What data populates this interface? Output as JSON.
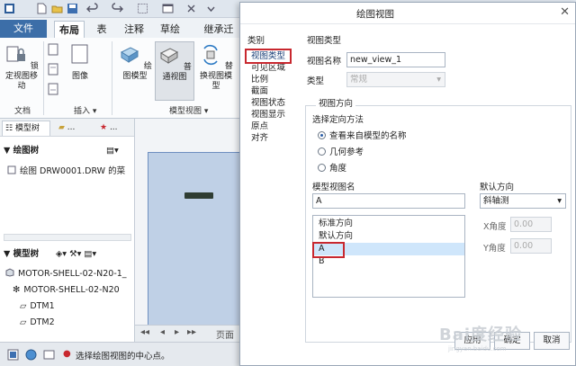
{
  "ribbon": {
    "tabs": [
      "文件",
      "布局",
      "表",
      "注释",
      "草绘",
      "继承迁"
    ],
    "buttons": {
      "lock_view_move": "锁定视图移动",
      "image": "图像",
      "drawing_model": "绘图模型",
      "general_view": "普通视图",
      "replace_view_model": "替换视图模型"
    },
    "groups": {
      "document": "文档",
      "insert": "插入",
      "model_views": "模型视图"
    }
  },
  "tree_panel": {
    "tabs": [
      "模型树",
      "...",
      "..."
    ],
    "drawing_tree_header": "绘图树",
    "drawing_tree_items": [
      "绘图 DRW0001.DRW 的菜"
    ],
    "model_tree_header": "模型树",
    "model_tree_items": [
      "MOTOR-SHELL-02-N20-1_",
      "MOTOR-SHELL-02-N20",
      "DTM1",
      "DTM2"
    ]
  },
  "page_nav": {
    "label": "页面"
  },
  "status": {
    "message": "选择绘图视图的中心点。"
  },
  "dialog": {
    "title": "绘图视图",
    "category_header": "类别",
    "categories": [
      "视图类型",
      "可见区域",
      "比例",
      "截面",
      "视图状态",
      "视图显示",
      "原点",
      "对齐"
    ],
    "view_type_header": "视图类型",
    "view_name_label": "视图名称",
    "view_name_value": "new_view_1",
    "type_label": "类型",
    "type_value": "常规",
    "orientation_header": "视图方向",
    "orientation_method_label": "选择定向方法",
    "orientation_options": [
      "查看来自模型的名称",
      "几何参考",
      "角度"
    ],
    "model_view_name_label": "模型视图名",
    "model_view_name_value": "A",
    "model_views": [
      "标准方向",
      "默认方向",
      "A",
      "B"
    ],
    "default_orientation_label": "默认方向",
    "default_orientation_value": "斜轴测",
    "x_angle_label": "X角度",
    "x_angle_value": "0.00",
    "y_angle_label": "Y角度",
    "y_angle_value": "0.00",
    "apply_label": "应用",
    "ok_label": "确定",
    "cancel_label": "取消"
  },
  "watermark": {
    "text": "Bai度经验",
    "sub": "jingyan.baidu.com"
  },
  "colors": {
    "accent": "#3c6ea8",
    "highlight_box": "#c8282f",
    "selection": "#cfe6fb"
  }
}
